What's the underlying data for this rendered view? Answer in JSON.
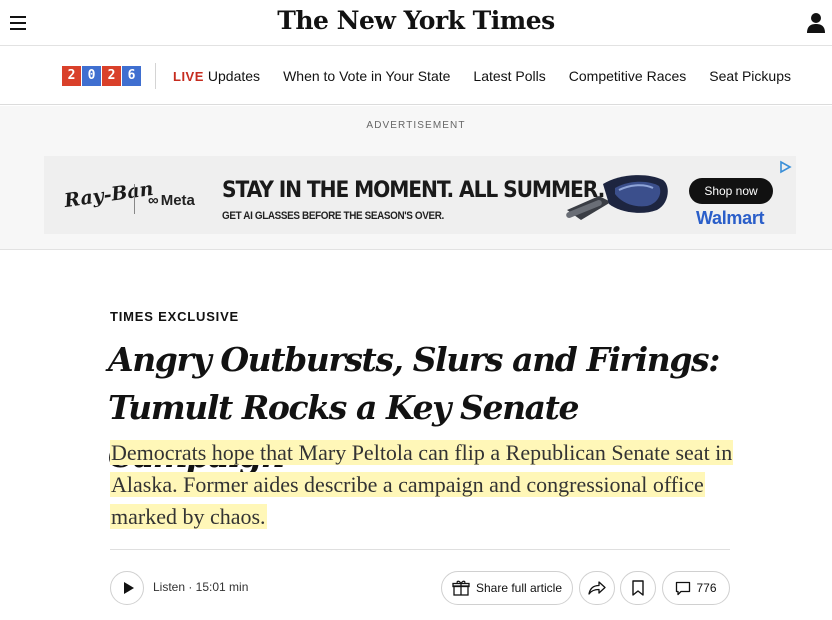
{
  "header": {
    "masthead": "The New York Times",
    "menu_icon": "hamburger-menu-icon",
    "account_icon": "user-icon"
  },
  "election_nav": {
    "badge_digits": [
      "2",
      "0",
      "2",
      "6"
    ],
    "badge_colors": [
      "#d9402a",
      "#3f6fd0",
      "#d9402a",
      "#3f6fd0"
    ],
    "live_label": "LIVE",
    "live_text": "Updates",
    "links": [
      "When to Vote in Your State",
      "Latest Polls",
      "Competitive Races",
      "Seat Pickups"
    ]
  },
  "ad": {
    "label": "ADVERTISEMENT",
    "brand1": "Ray-Ban",
    "brand2": "Meta",
    "headline": "STAY IN THE MOMENT. ALL SUMMER.",
    "subline": "GET AI GLASSES BEFORE THE SEASON'S OVER.",
    "cta": "Shop now",
    "retailer": "Walmart"
  },
  "article": {
    "kicker": "TIMES EXCLUSIVE",
    "headline_line1": "Angry Outbursts, Slurs and Firings:",
    "headline_line2": "Tumult Rocks a Key Senate Campaign",
    "summary": "Democrats hope that Mary Peltola can flip a Republican Senate seat in Alaska. Former aides describe a campaign and congressional office marked by chaos."
  },
  "actions": {
    "listen_label": "Listen · 15:01 min",
    "share_label": "Share full article",
    "comment_count": "776"
  }
}
